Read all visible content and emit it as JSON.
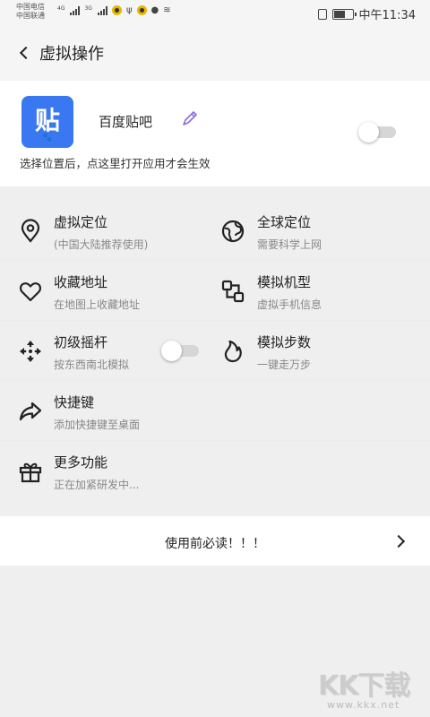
{
  "status_bar": {
    "carrier_1": "中国电信",
    "carrier_2": "中国联通",
    "sig_label_1": "4G",
    "sig_label_2": "3G",
    "time": "中午11:34"
  },
  "header": {
    "title": "虚拟操作"
  },
  "app_card": {
    "logo_glyph": "贴",
    "logo_small": "🐾",
    "name": "百度贴吧",
    "hint": "选择位置后，点这里打开应用才会生效",
    "toggle_on": false
  },
  "features": [
    {
      "title": "虚拟定位",
      "subtitle": "(中国大陆推荐使用)",
      "icon": "location-pin-icon"
    },
    {
      "title": "全球定位",
      "subtitle": "需要科学上网",
      "icon": "globe-icon"
    },
    {
      "title": "收藏地址",
      "subtitle": "在地图上收藏地址",
      "icon": "heart-icon"
    },
    {
      "title": "模拟机型",
      "subtitle": "虚拟手机信息",
      "icon": "device-model-icon"
    },
    {
      "title": "初级摇杆",
      "subtitle": "按东西南北模拟",
      "icon": "move-arrows-icon",
      "toggle_on": false
    },
    {
      "title": "模拟步数",
      "subtitle": "一键走万步",
      "icon": "flame-icon"
    },
    {
      "title": "快捷键",
      "subtitle": "添加快捷键至桌面",
      "icon": "share-arrow-icon"
    },
    {
      "title": "更多功能",
      "subtitle": "正在加紧研发中...",
      "icon": "gift-icon"
    }
  ],
  "notice": {
    "label": "使用前必读！！！"
  },
  "watermark": {
    "main": "KK下载",
    "url": "www.kkx.net"
  }
}
